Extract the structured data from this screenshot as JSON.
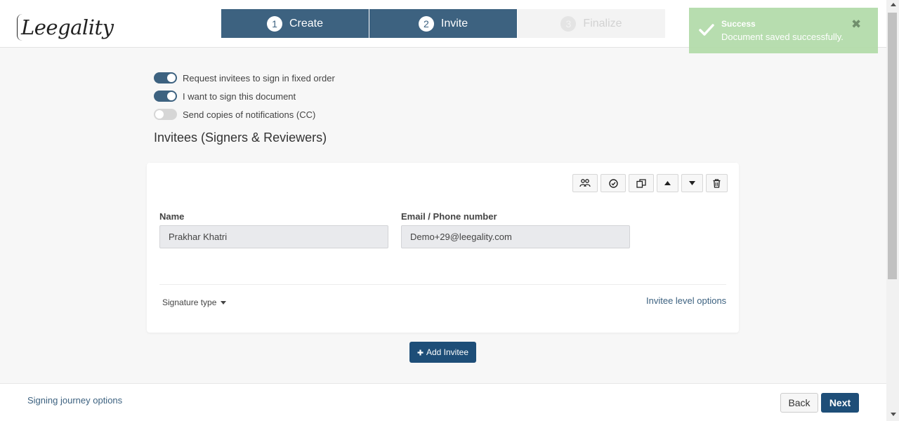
{
  "header": {
    "logo_text": "Leegality",
    "steps": [
      {
        "num": "1",
        "label": "Create",
        "state": "active"
      },
      {
        "num": "2",
        "label": "Invite",
        "state": "active"
      },
      {
        "num": "3",
        "label": "Finalize",
        "state": "inactive"
      }
    ]
  },
  "toast": {
    "title": "Success",
    "message": "Document saved successfully.",
    "close_glyph": "✖"
  },
  "options": [
    {
      "label": "Request invitees to sign in fixed order",
      "on": true
    },
    {
      "label": "I want to sign this document",
      "on": true
    },
    {
      "label": "Send copies of notifications (CC)",
      "on": false
    }
  ],
  "section_title": "Invitees (Signers & Reviewers)",
  "invitee": {
    "toolbar_icons": [
      "group-icon",
      "check-circle-icon",
      "copy-icon",
      "arrow-up-icon",
      "arrow-down-icon",
      "trash-icon"
    ],
    "name_label": "Name",
    "name_value": "Prakhar Khatri",
    "contact_label": "Email / Phone number",
    "contact_value": "Demo+29@leegality.com",
    "signature_type_label": "Signature type",
    "invitee_options_label": "Invitee level options"
  },
  "add_invitee_label": "Add Invitee",
  "footer": {
    "journey_label": "Signing journey options",
    "back_label": "Back",
    "next_label": "Next"
  },
  "colors": {
    "primary": "#3d6280",
    "button": "#1e4e78",
    "toast": "#b4dcab"
  }
}
